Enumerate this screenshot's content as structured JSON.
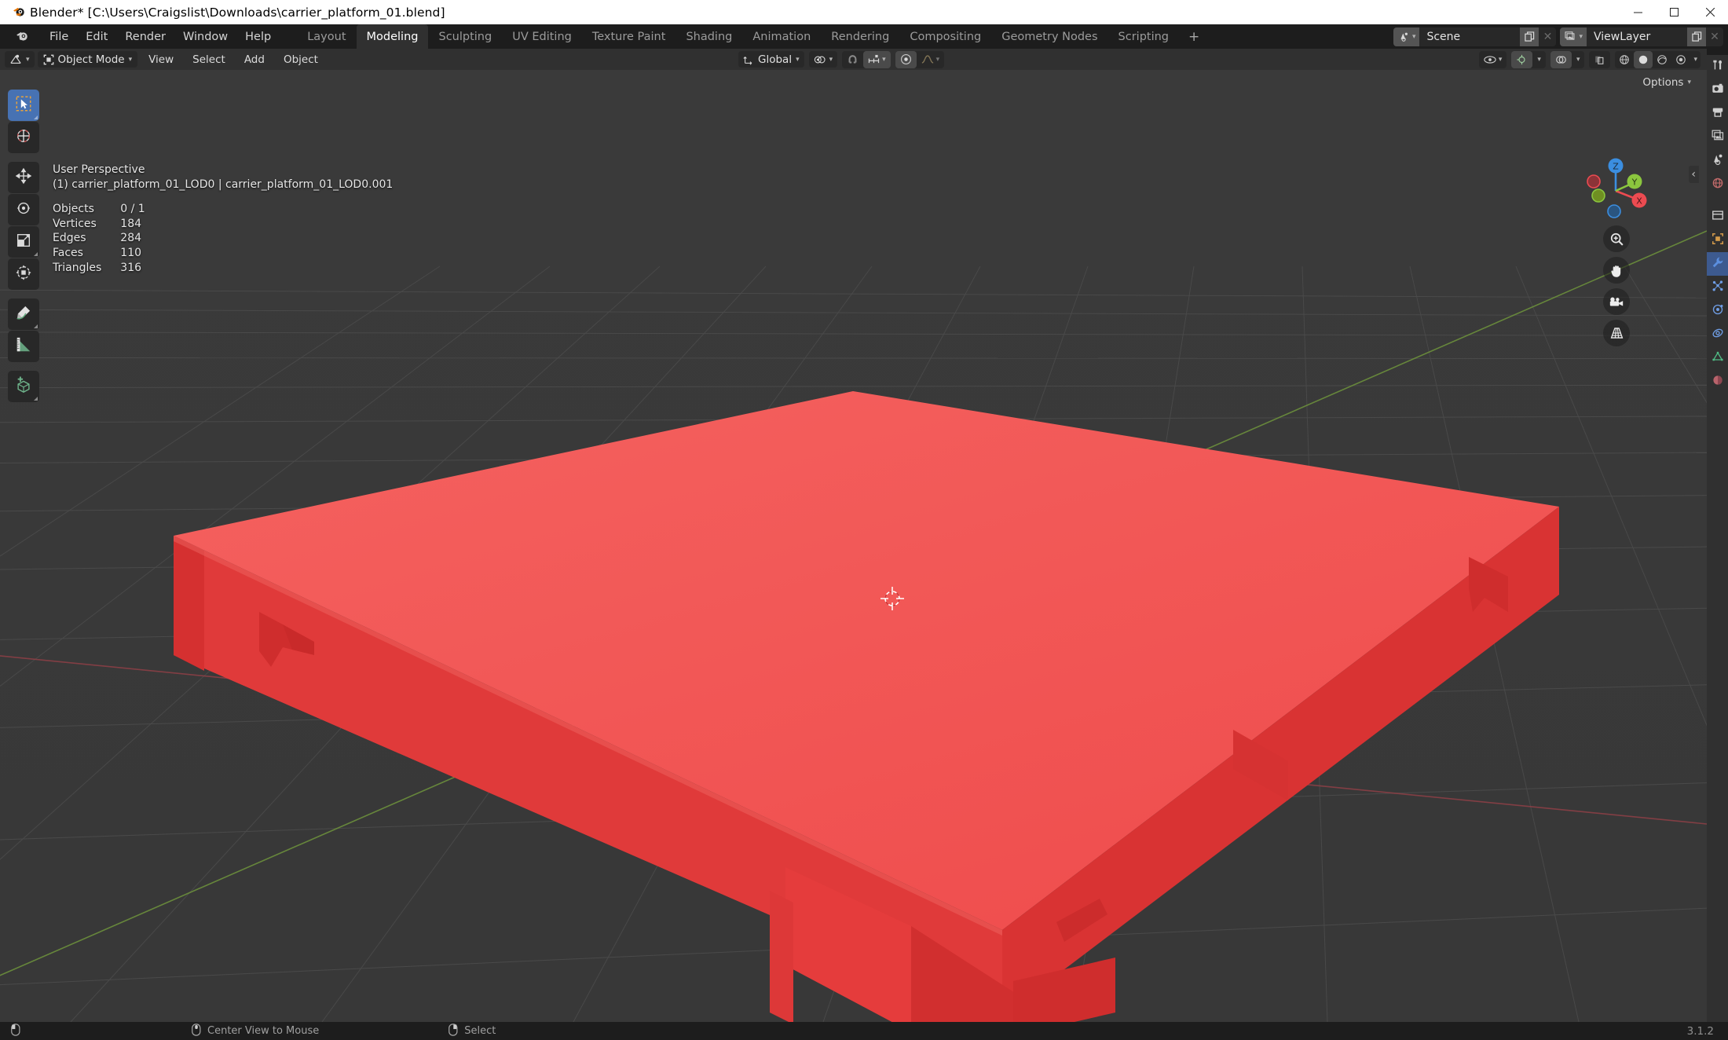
{
  "window": {
    "title": "Blender* [C:\\Users\\Craigslist\\Downloads\\carrier_platform_01.blend]",
    "minimize_label": "—",
    "maximize_label": "▢",
    "close_label": "✕"
  },
  "topbar": {
    "logo_icon": "blender-logo-icon",
    "menus": [
      "File",
      "Edit",
      "Render",
      "Window",
      "Help"
    ],
    "workspaces": [
      {
        "label": "Layout",
        "active": false
      },
      {
        "label": "Modeling",
        "active": true
      },
      {
        "label": "Sculpting",
        "active": false
      },
      {
        "label": "UV Editing",
        "active": false
      },
      {
        "label": "Texture Paint",
        "active": false
      },
      {
        "label": "Shading",
        "active": false
      },
      {
        "label": "Animation",
        "active": false
      },
      {
        "label": "Rendering",
        "active": false
      },
      {
        "label": "Compositing",
        "active": false
      },
      {
        "label": "Geometry Nodes",
        "active": false
      },
      {
        "label": "Scripting",
        "active": false
      }
    ],
    "add_workspace_label": "+",
    "scene": {
      "icon": "scene-icon",
      "name": "Scene",
      "new_icon": "duplicate-icon",
      "unlink_icon": "x-icon"
    },
    "view_layer": {
      "icon": "view-layer-icon",
      "name": "ViewLayer",
      "new_icon": "duplicate-icon",
      "unlink_icon": "x-icon"
    }
  },
  "viewport_header": {
    "editor_type_icon": "editor-type-3dview-icon",
    "mode": "Object Mode",
    "mode_icon": "object-mode-icon",
    "menus": [
      "View",
      "Select",
      "Add",
      "Object"
    ],
    "transform_orientation": "Global",
    "transform_orientation_icon": "orientation-icon",
    "pivot_icon": "pivot-point-icon",
    "snap_icon": "snap-magnet-icon",
    "snap_target_icon": "snap-increment-icon",
    "proportional_icon": "proportional-edit-icon",
    "falloff_icon": "falloff-smooth-icon",
    "visibility_icon": "visibility-eye-icon",
    "gizmo_icon": "gizmo-icon",
    "overlays_icon": "overlays-icon",
    "xray_icon": "xray-toggle-icon",
    "shading_modes": [
      "wireframe",
      "solid",
      "material-preview",
      "rendered"
    ],
    "shading_active_index": 1
  },
  "viewport": {
    "options_label": "Options",
    "options_chevron": "chevron-down-icon",
    "overlay": {
      "view_name": "User Perspective",
      "object_line": "(1) carrier_platform_01_LOD0 | carrier_platform_01_LOD0.001",
      "stats": [
        {
          "label": "Objects",
          "value": "0 / 1"
        },
        {
          "label": "Vertices",
          "value": "184"
        },
        {
          "label": "Edges",
          "value": "284"
        },
        {
          "label": "Faces",
          "value": "110"
        },
        {
          "label": "Triangles",
          "value": "316"
        }
      ]
    },
    "gizmo": {
      "axis_x": "X",
      "axis_y": "Y",
      "axis_z": "Z",
      "color_x": "#ec4b51",
      "color_y": "#8bc63e",
      "color_z": "#3b8ee0"
    },
    "nav_icons": [
      "zoom-icon",
      "hand-pan-icon",
      "camera-view-icon",
      "ortho-persp-grid-icon"
    ],
    "sidebar_toggle_icon": "chevron-left-icon",
    "mesh_color": "#f04a4a",
    "background_color": "#393939"
  },
  "toolbar": {
    "tools": [
      {
        "name": "tweak-select-box-tool",
        "icon": "select-box-icon",
        "active": true
      },
      {
        "name": "cursor-tool",
        "icon": "cursor-3d-icon",
        "active": false
      },
      {
        "name": "move-tool",
        "icon": "move-arrows-icon",
        "active": false
      },
      {
        "name": "rotate-tool",
        "icon": "rotate-icon",
        "active": false
      },
      {
        "name": "scale-tool",
        "icon": "scale-icon",
        "active": false
      },
      {
        "name": "transform-tool",
        "icon": "transform-icon",
        "active": false
      },
      {
        "name": "annotate-tool",
        "icon": "pencil-annotate-icon",
        "active": false
      },
      {
        "name": "measure-tool",
        "icon": "ruler-measure-icon",
        "active": false
      },
      {
        "name": "add-cube-tool",
        "icon": "add-cube-icon",
        "active": false
      }
    ]
  },
  "properties_tabs": [
    {
      "name": "tool-tab",
      "icon": "tool-wrench-screwdriver-icon",
      "state": "normal"
    },
    {
      "name": "render-tab",
      "icon": "render-camera-back-icon",
      "state": "normal"
    },
    {
      "name": "output-tab",
      "icon": "output-printer-icon",
      "state": "normal"
    },
    {
      "name": "view-layer-tab",
      "icon": "view-layer-images-icon",
      "state": "normal"
    },
    {
      "name": "scene-tab",
      "icon": "scene-cone-icon",
      "state": "normal"
    },
    {
      "name": "world-tab",
      "icon": "world-globe-icon",
      "state": "normal"
    },
    {
      "name": "collection-tab",
      "icon": "collection-box-icon",
      "state": "normal"
    },
    {
      "name": "object-tab",
      "icon": "object-square-icon",
      "state": "normal"
    },
    {
      "name": "modifier-tab",
      "icon": "modifier-wrench-icon",
      "state": "selected"
    },
    {
      "name": "particles-tab",
      "icon": "particles-icon",
      "state": "normal"
    },
    {
      "name": "physics-tab",
      "icon": "physics-orbit-icon",
      "state": "normal"
    },
    {
      "name": "constraints-tab",
      "icon": "constraints-icon",
      "state": "normal"
    },
    {
      "name": "data-tab",
      "icon": "mesh-data-triangle-icon",
      "state": "normal"
    },
    {
      "name": "material-tab",
      "icon": "material-sphere-icon",
      "state": "normal"
    }
  ],
  "statusbar": {
    "items": [
      {
        "icon": "mouse-left-icon",
        "label": ""
      },
      {
        "icon": "mouse-middle-icon",
        "label": "Center View to Mouse"
      },
      {
        "icon": "mouse-right-icon",
        "label": "Select"
      }
    ],
    "version": "3.1.2"
  }
}
